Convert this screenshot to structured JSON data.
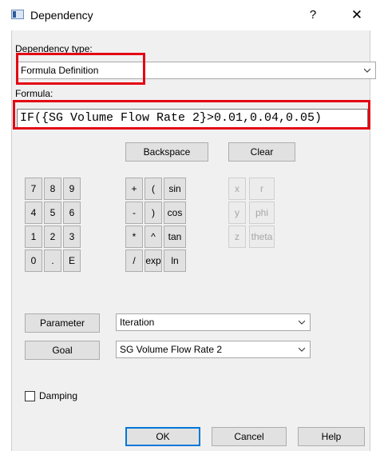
{
  "window": {
    "title": "Dependency",
    "help": "?",
    "close": "✕"
  },
  "dependency_type": {
    "label": "Dependency type:",
    "value": "Formula Definition"
  },
  "formula": {
    "label": "Formula:",
    "value": "IF({SG Volume Flow Rate 2}>0.01,0.04,0.05)"
  },
  "actions": {
    "backspace": "Backspace",
    "clear": "Clear"
  },
  "digits": [
    "7",
    "8",
    "9",
    "4",
    "5",
    "6",
    "1",
    "2",
    "3",
    "0",
    ".",
    "E"
  ],
  "operators": [
    "+",
    "(",
    "sin",
    "-",
    ")",
    "cos",
    "*",
    "^",
    "tan",
    "/",
    "exp",
    "ln"
  ],
  "variables": [
    "x",
    "r",
    "y",
    "phi",
    "z",
    "theta"
  ],
  "parameter": {
    "button": "Parameter",
    "value": "Iteration"
  },
  "goal": {
    "button": "Goal",
    "value": "SG Volume Flow Rate 2"
  },
  "damping": {
    "label": "Damping",
    "checked": false
  },
  "footer": {
    "ok": "OK",
    "cancel": "Cancel",
    "help": "Help"
  },
  "colors": {
    "highlight": "#e30613",
    "accent": "#0078d7"
  }
}
